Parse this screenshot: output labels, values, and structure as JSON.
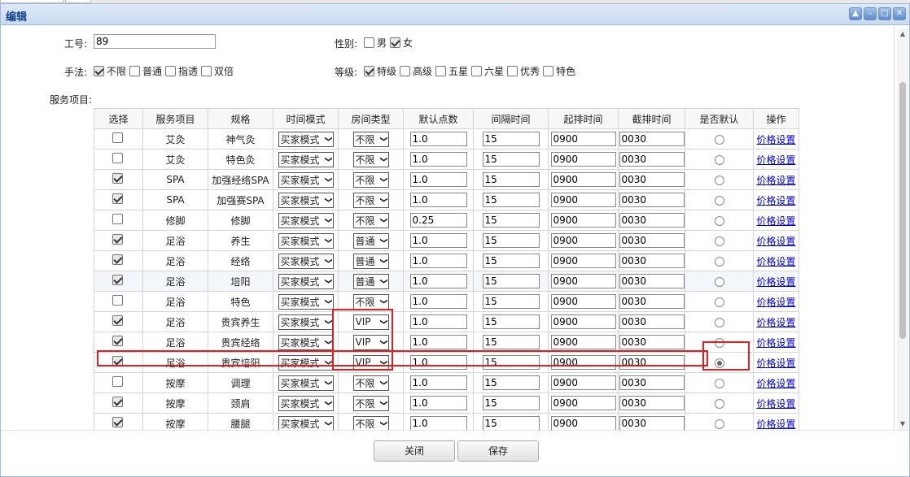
{
  "window": {
    "title": "编辑",
    "btn_collapse": "▲",
    "btn_minimize": "–",
    "btn_maximize": "□",
    "btn_close": "✕"
  },
  "form": {
    "employee_label": "工号:",
    "employee_value": "89",
    "gender_label": "性别:",
    "gender_options": [
      {
        "label": "男",
        "checked": false
      },
      {
        "label": "女",
        "checked": true
      }
    ],
    "technique_label": "手法:",
    "technique_options": [
      {
        "label": "不限",
        "checked": true
      },
      {
        "label": "普通",
        "checked": false
      },
      {
        "label": "指透",
        "checked": false
      },
      {
        "label": "双倍",
        "checked": false
      }
    ],
    "grade_label": "等级:",
    "grade_options": [
      {
        "label": "特级",
        "checked": true
      },
      {
        "label": "高级",
        "checked": false
      },
      {
        "label": "五星",
        "checked": false
      },
      {
        "label": "六星",
        "checked": false
      },
      {
        "label": "优秀",
        "checked": false
      },
      {
        "label": "特色",
        "checked": false
      }
    ],
    "services_label": "服务项目:"
  },
  "table": {
    "columns": [
      "选择",
      "服务项目",
      "规格",
      "时间模式",
      "房间类型",
      "默认点数",
      "间隔时间",
      "起排时间",
      "截排时间",
      "是否默认",
      "操作"
    ],
    "rows": [
      {
        "checked": false,
        "service": "艾灸",
        "spec": "神气灸",
        "time_mode": "买家模式",
        "room": "不限",
        "points": "1.0",
        "interval": "15",
        "start": "0900",
        "end": "0030",
        "default": false,
        "action": "价格设置"
      },
      {
        "checked": false,
        "service": "艾灸",
        "spec": "特色灸",
        "time_mode": "买家模式",
        "room": "不限",
        "points": "1.0",
        "interval": "15",
        "start": "0900",
        "end": "0030",
        "default": false,
        "action": "价格设置"
      },
      {
        "checked": true,
        "service": "SPA",
        "spec": "加强经络SPA",
        "time_mode": "买家模式",
        "room": "不限",
        "points": "1.0",
        "interval": "15",
        "start": "0900",
        "end": "0030",
        "default": false,
        "action": "价格设置"
      },
      {
        "checked": true,
        "service": "SPA",
        "spec": "加强赛SPA",
        "time_mode": "买家模式",
        "room": "不限",
        "points": "1.0",
        "interval": "15",
        "start": "0900",
        "end": "0030",
        "default": false,
        "action": "价格设置"
      },
      {
        "checked": false,
        "service": "修脚",
        "spec": "修脚",
        "time_mode": "买家模式",
        "room": "不限",
        "points": "0.25",
        "interval": "15",
        "start": "0900",
        "end": "0030",
        "default": false,
        "action": "价格设置"
      },
      {
        "checked": true,
        "service": "足浴",
        "spec": "养生",
        "time_mode": "买家模式",
        "room": "普通",
        "points": "1.0",
        "interval": "15",
        "start": "0900",
        "end": "0030",
        "default": false,
        "action": "价格设置"
      },
      {
        "checked": true,
        "service": "足浴",
        "spec": "经络",
        "time_mode": "买家模式",
        "room": "普通",
        "points": "1.0",
        "interval": "15",
        "start": "0900",
        "end": "0030",
        "default": false,
        "action": "价格设置"
      },
      {
        "checked": true,
        "service": "足浴",
        "spec": "培阳",
        "time_mode": "买家模式",
        "room": "普通",
        "points": "1.0",
        "interval": "15",
        "start": "0900",
        "end": "0030",
        "default": false,
        "action": "价格设置"
      },
      {
        "checked": false,
        "service": "足浴",
        "spec": "特色",
        "time_mode": "买家模式",
        "room": "不限",
        "points": "1.0",
        "interval": "15",
        "start": "0900",
        "end": "0030",
        "default": false,
        "action": "价格设置"
      },
      {
        "checked": true,
        "service": "足浴",
        "spec": "贵宾养生",
        "time_mode": "买家模式",
        "room": "VIP",
        "points": "1.0",
        "interval": "15",
        "start": "0900",
        "end": "0030",
        "default": false,
        "action": "价格设置"
      },
      {
        "checked": true,
        "service": "足浴",
        "spec": "贵宾经络",
        "time_mode": "买家模式",
        "room": "VIP",
        "points": "1.0",
        "interval": "15",
        "start": "0900",
        "end": "0030",
        "default": false,
        "action": "价格设置"
      },
      {
        "checked": true,
        "service": "足浴",
        "spec": "贵宾培阳",
        "time_mode": "买家模式",
        "room": "VIP",
        "points": "1.0",
        "interval": "15",
        "start": "0900",
        "end": "0030",
        "default": true,
        "action": "价格设置"
      },
      {
        "checked": false,
        "service": "按摩",
        "spec": "调理",
        "time_mode": "买家模式",
        "room": "不限",
        "points": "1.0",
        "interval": "15",
        "start": "0900",
        "end": "0030",
        "default": false,
        "action": "价格设置"
      },
      {
        "checked": true,
        "service": "按摩",
        "spec": "颈肩",
        "time_mode": "买家模式",
        "room": "不限",
        "points": "1.0",
        "interval": "15",
        "start": "0900",
        "end": "0030",
        "default": false,
        "action": "价格设置"
      },
      {
        "checked": true,
        "service": "按摩",
        "spec": "腰腿",
        "time_mode": "买家模式",
        "room": "不限",
        "points": "1.0",
        "interval": "15",
        "start": "0900",
        "end": "0030",
        "default": false,
        "action": "价格设置"
      }
    ]
  },
  "footer": {
    "close_label": "关闭",
    "save_label": "保存"
  },
  "colors": {
    "highlight_box": "#e02020",
    "link": "#0000cc",
    "title_text": "#15428b"
  }
}
